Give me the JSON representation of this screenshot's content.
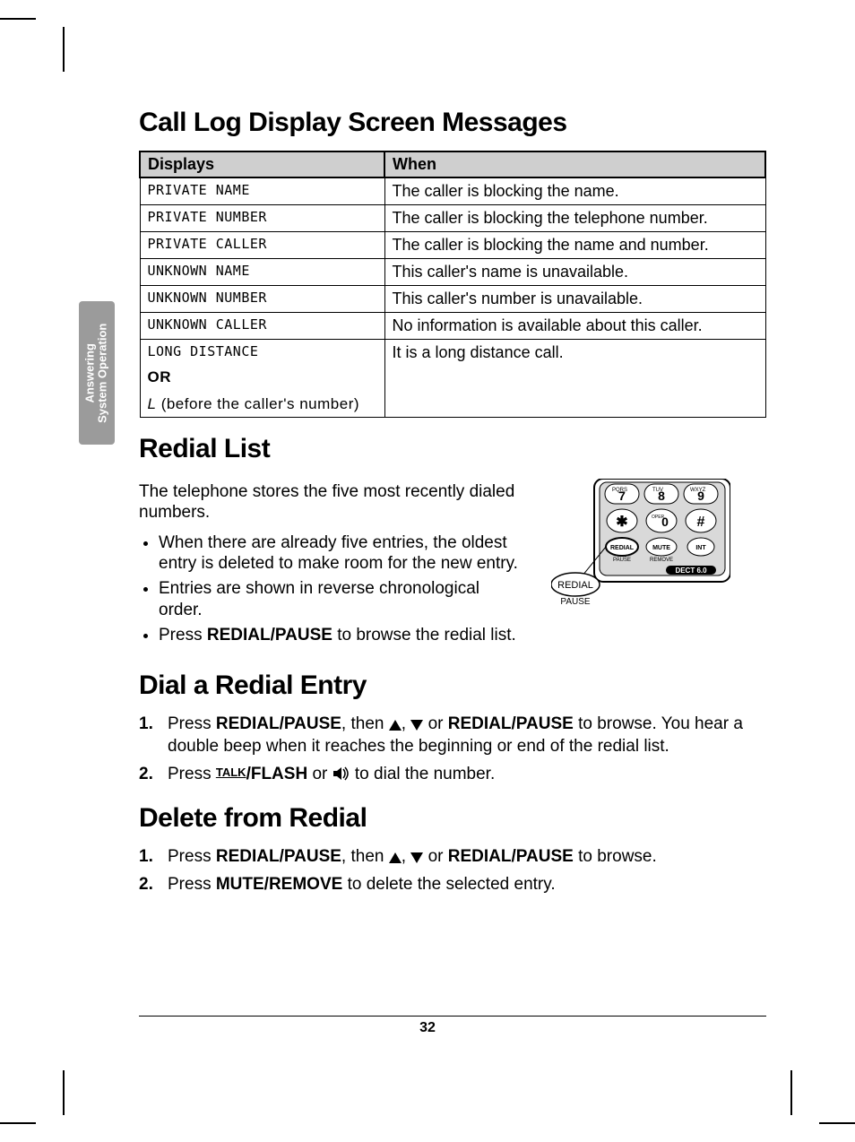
{
  "side_tab": {
    "line1": "Answering",
    "line2": "System Operation"
  },
  "section1": {
    "title": "Call Log Display Screen Messages",
    "headers": {
      "col1": "Displays",
      "col2": "When"
    },
    "rows": [
      {
        "display": "PRIVATE NAME",
        "when": "The caller is blocking the name."
      },
      {
        "display": "PRIVATE NUMBER",
        "when": "The caller is blocking the telephone number."
      },
      {
        "display": "PRIVATE CALLER",
        "when": "The caller is blocking the name and number."
      },
      {
        "display": "UNKNOWN NAME",
        "when": "This caller's name is unavailable."
      },
      {
        "display": "UNKNOWN NUMBER",
        "when": "This caller's number is unavailable."
      },
      {
        "display": "UNKNOWN CALLER",
        "when": "No information is available about this caller."
      }
    ],
    "last_row": {
      "display": "LONG DISTANCE",
      "or": "OR",
      "sub_prefix": "L",
      "sub_rest": " (before the caller's number)",
      "when": "It is a long distance call."
    }
  },
  "section2": {
    "title": "Redial List",
    "intro": "The telephone stores the five most recently dialed numbers.",
    "bullets": [
      "When there are already five entries, the oldest entry is deleted to make room for the new entry.",
      "Entries are shown in reverse chronological order."
    ],
    "bullet3_pre": "Press ",
    "bullet3_bold": "REDIAL/PAUSE",
    "bullet3_post": " to browse the redial list."
  },
  "diagram": {
    "keys": {
      "seven": "7",
      "eight": "8",
      "nine": "9",
      "star": "✱",
      "zero": "0",
      "hash": "#",
      "pqrs": "PQRS",
      "tuv": "TUV",
      "wxyz": "WXYZ",
      "oper": "OPER"
    },
    "btn_redial_top": "REDIAL",
    "btn_redial_sub": "PAUSE",
    "btn_mute_top": "MUTE",
    "btn_mute_sub": "REMOVE",
    "btn_int": "INT",
    "logo": "DECT 6.0",
    "callout_top": "REDIAL",
    "callout_bottom": "PAUSE"
  },
  "section3": {
    "title": "Dial a Redial Entry",
    "step1": {
      "t1": "Press ",
      "b1": "REDIAL/PAUSE",
      "t2": ", then ",
      "t3": ", ",
      "t4": " or ",
      "b2": "REDIAL/PAUSE",
      "t5": " to browse. You hear a double beep when it reaches the beginning or end of the redial list."
    },
    "step2": {
      "t1": "Press ",
      "talk": "TALK",
      "b1": "/FLASH",
      "t2": " or ",
      "t3": " to dial the number."
    }
  },
  "section4": {
    "title": "Delete from Redial",
    "step1": {
      "t1": "Press ",
      "b1": "REDIAL/PAUSE",
      "t2": ", then ",
      "t3": ", ",
      "t4": " or ",
      "b2": "REDIAL/PAUSE",
      "t5": " to browse."
    },
    "step2": {
      "t1": "Press ",
      "b1": "MUTE/REMOVE",
      "t2": " to delete the selected entry."
    }
  },
  "page_number": "32"
}
